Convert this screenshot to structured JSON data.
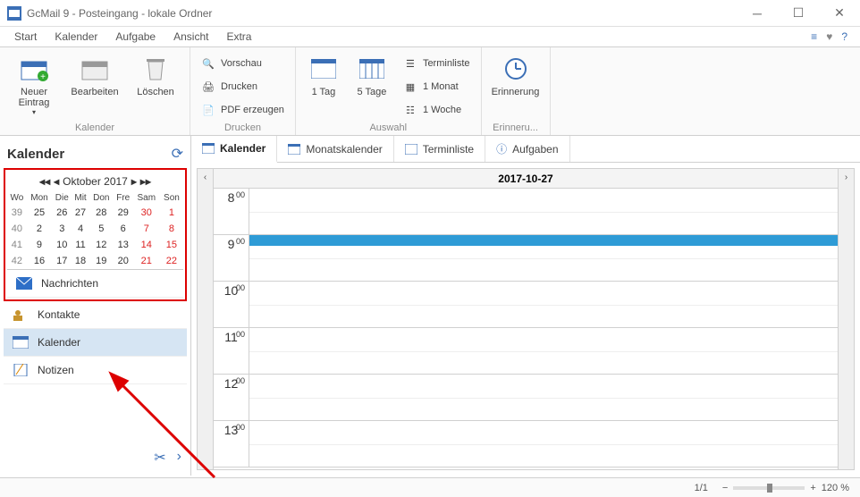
{
  "window": {
    "title": "GcMail 9 - Posteingang - lokale Ordner"
  },
  "menu": [
    "Start",
    "Kalender",
    "Aufgabe",
    "Ansicht",
    "Extra"
  ],
  "ribbon": {
    "g1": {
      "caption": "Kalender",
      "new": "Neuer Eintrag",
      "edit": "Bearbeiten",
      "del": "Löschen"
    },
    "g2": {
      "caption": "Drucken",
      "preview": "Vorschau",
      "print": "Drucken",
      "pdf": "PDF erzeugen"
    },
    "g3": {
      "caption": "Auswahl",
      "d1": "1 Tag",
      "d5": "5 Tage",
      "list": "Terminliste",
      "m1": "1 Monat",
      "w1": "1 Woche"
    },
    "g4": {
      "caption": "Erinneru...",
      "rem": "Erinnerung"
    }
  },
  "sidebar": {
    "title": "Kalender",
    "month": "Oktober 2017",
    "wdays": [
      "Wo",
      "Mon",
      "Die",
      "Mit",
      "Don",
      "Fre",
      "Sam",
      "Son"
    ],
    "weeks": [
      [
        39,
        25,
        26,
        27,
        28,
        29,
        30,
        1
      ],
      [
        40,
        2,
        3,
        4,
        5,
        6,
        7,
        8
      ],
      [
        41,
        9,
        10,
        11,
        12,
        13,
        14,
        15
      ],
      [
        42,
        16,
        17,
        18,
        19,
        20,
        21,
        22
      ]
    ],
    "nav": {
      "msg": "Nachrichten",
      "con": "Kontakte",
      "cal": "Kalender",
      "not": "Notizen"
    }
  },
  "tabs": [
    "Kalender",
    "Monatskalender",
    "Terminliste",
    "Aufgaben"
  ],
  "schedule": {
    "date": "2017-10-27",
    "hours": [
      8,
      9,
      10,
      11,
      12,
      13
    ]
  },
  "status": {
    "page": "1/1",
    "zoom": "120 %"
  }
}
